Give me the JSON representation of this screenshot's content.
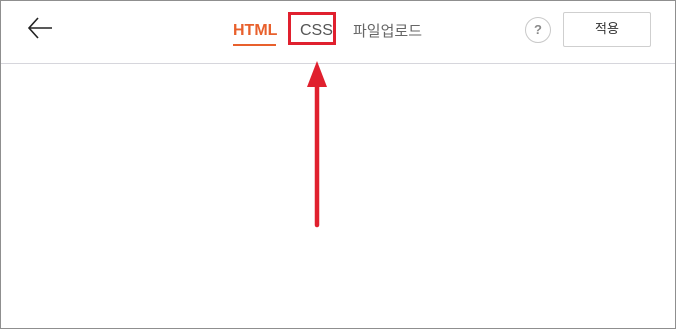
{
  "header": {
    "back_icon": "arrow-left-icon",
    "tabs": [
      {
        "label": "HTML",
        "active": true
      },
      {
        "label": "CSS",
        "active": false
      },
      {
        "label": "파일업로드",
        "active": false
      }
    ],
    "help_label": "?",
    "apply_label": "적용"
  },
  "annotation": {
    "highlight_color": "#e0202e",
    "arrow_icon": "arrow-up-icon"
  },
  "colors": {
    "accent": "#e8602c",
    "annotation": "#e0202e"
  }
}
